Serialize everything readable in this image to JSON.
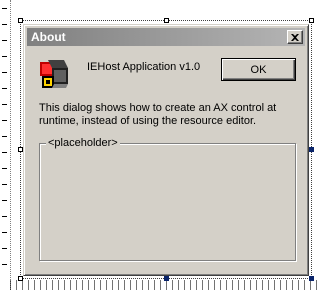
{
  "dialog": {
    "title": "About",
    "close_symbol": "close-icon",
    "app_icon": "app-logo-icon",
    "version_text": "IEHost Application v1.0",
    "ok_label": "OK",
    "description": "This dialog shows how to create an AX control at runtime, instead of using the resource editor.",
    "placeholder_label": "<placeholder>"
  },
  "colors": {
    "dialog_face": "#d4d0c8",
    "title_bar_inactive_start": "#808080",
    "title_bar_inactive_end": "#b5b5b5",
    "selection_handle": "#0a246a"
  }
}
